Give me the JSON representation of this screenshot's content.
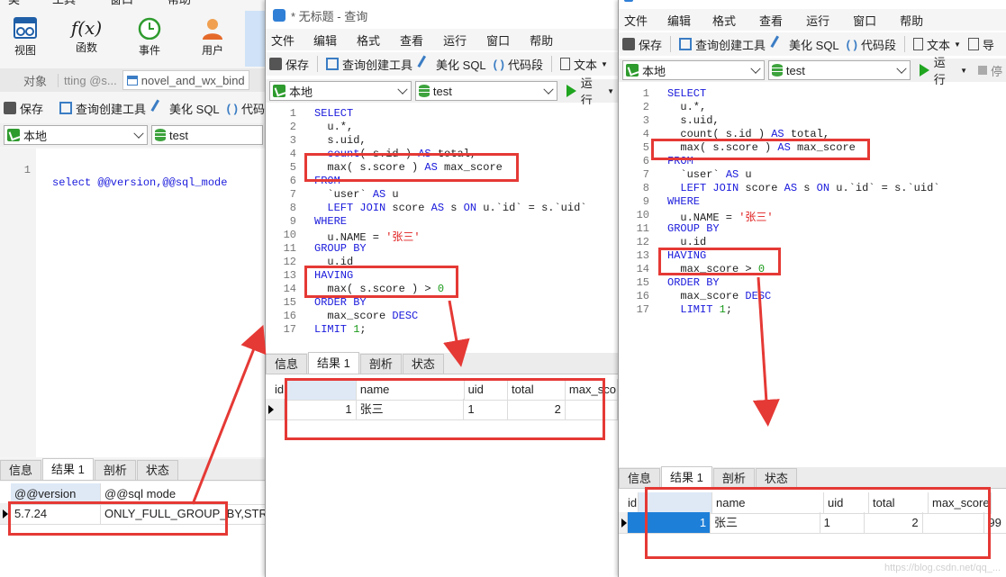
{
  "main": {
    "top_menu": [
      "类",
      "工具",
      "窗口",
      "帮助"
    ],
    "big_toolbar": [
      {
        "label": "视图",
        "icon": "grid-view-icon"
      },
      {
        "label": "函数",
        "icon": "function-icon"
      },
      {
        "label": "事件",
        "icon": "clock-icon"
      },
      {
        "label": "用户",
        "icon": "user-icon"
      }
    ],
    "object_tabs": [
      "对象",
      "tting @s...",
      "novel_and_wx_bind"
    ],
    "toolbar": {
      "save": "保存",
      "query_builder": "查询创建工具",
      "beautify": "美化 SQL",
      "snippet": "代码"
    },
    "connection": "本地",
    "database": "test",
    "editor_lines": [
      {
        "n": "1",
        "code": "select @@version,@@sql_mode"
      }
    ],
    "result_tabs": [
      "信息",
      "结果 1",
      "剖析",
      "状态"
    ],
    "result_headers": [
      "@@version",
      "@@sql mode"
    ],
    "result_row": [
      "5.7.24",
      "ONLY_FULL_GROUP_BY,STRICT_"
    ]
  },
  "left_query": {
    "title": "* 无标题 - 查询",
    "menu": [
      "文件",
      "编辑",
      "格式",
      "查看",
      "运行",
      "窗口",
      "帮助"
    ],
    "toolbar": {
      "save": "保存",
      "query_builder": "查询创建工具",
      "beautify": "美化 SQL",
      "snippet": "代码段",
      "text": "文本"
    },
    "connection": "本地",
    "database": "test",
    "run": "运行",
    "line_numbers": [
      "1",
      "2",
      "3",
      "4",
      "5",
      "6",
      "7",
      "8",
      "9",
      "10",
      "11",
      "12",
      "13",
      "14",
      "15",
      "16",
      "17"
    ],
    "result_tabs": [
      "信息",
      "结果 1",
      "剖析",
      "状态"
    ],
    "result_headers": [
      "id",
      "name",
      "uid",
      "total",
      "max_sco"
    ],
    "result_row": [
      "1",
      "张三",
      "1",
      "2",
      ""
    ]
  },
  "right_query": {
    "menu": [
      "文件",
      "编辑",
      "格式",
      "查看",
      "运行",
      "窗口",
      "帮助"
    ],
    "toolbar": {
      "save": "保存",
      "query_builder": "查询创建工具",
      "beautify": "美化 SQL",
      "snippet": "代码段",
      "text": "文本",
      "export": "导"
    },
    "connection": "本地",
    "database": "test",
    "run": "运行",
    "stop": "停",
    "line_numbers": [
      "1",
      "2",
      "3",
      "4",
      "5",
      "6",
      "7",
      "8",
      "9",
      "10",
      "11",
      "12",
      "13",
      "14",
      "15",
      "16",
      "17"
    ],
    "result_tabs": [
      "信息",
      "结果 1",
      "剖析",
      "状态"
    ],
    "result_headers": [
      "id",
      "name",
      "uid",
      "total",
      "max_score"
    ],
    "result_row": [
      "1",
      "张三",
      "1",
      "2",
      "",
      "99"
    ]
  },
  "watermark": "https://blog.csdn.net/qq_..."
}
